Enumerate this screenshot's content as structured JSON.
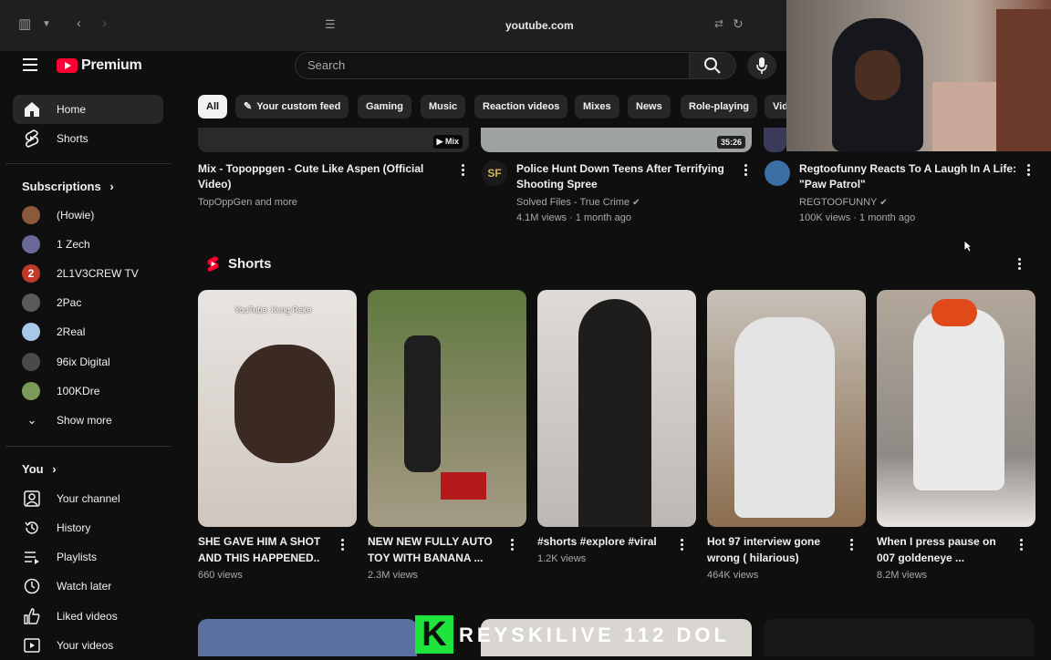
{
  "browser": {
    "url": "youtube.com"
  },
  "header": {
    "brand": "Premium",
    "search_placeholder": "Search"
  },
  "sidebar": {
    "main": [
      {
        "label": "Home",
        "icon": "home-icon",
        "active": true
      },
      {
        "label": "Shorts",
        "icon": "shorts-icon",
        "active": false
      }
    ],
    "subscriptions_heading": "Subscriptions",
    "subscriptions": [
      {
        "label": "(Howie)",
        "color": "#8a5a3a"
      },
      {
        "label": "1 Zech",
        "color": "#6a6a9a"
      },
      {
        "label": "2L1V3CREW TV",
        "color": "#c0392b",
        "glyph": "2"
      },
      {
        "label": "2Pac",
        "color": "#5a5a5a"
      },
      {
        "label": "2Real",
        "color": "#a8c8e8"
      },
      {
        "label": "96ix Digital",
        "color": "#4a4a4a"
      },
      {
        "label": "100KDre",
        "color": "#7a9a5a"
      }
    ],
    "show_more": "Show more",
    "you_heading": "You",
    "you_items": [
      {
        "label": "Your channel",
        "icon": "channel-icon"
      },
      {
        "label": "History",
        "icon": "history-icon"
      },
      {
        "label": "Playlists",
        "icon": "playlists-icon"
      },
      {
        "label": "Watch later",
        "icon": "watch-later-icon"
      },
      {
        "label": "Liked videos",
        "icon": "thumbs-up-icon"
      },
      {
        "label": "Your videos",
        "icon": "your-videos-icon"
      }
    ]
  },
  "chips": [
    "All",
    "Your custom feed",
    "Gaming",
    "Music",
    "Reaction videos",
    "Mixes",
    "News",
    "Role-playing",
    "Vid"
  ],
  "videos": [
    {
      "title_line1": "Mix - Topoppgen - Cute Like Aspen (Official",
      "title_line2": "Video)",
      "meta1": "TopOppGen and more",
      "meta2": "",
      "badge": "Mix",
      "avatar": ""
    },
    {
      "title_line1": "Police Hunt Down Teens After Terrifying",
      "title_line2": "Shooting Spree",
      "meta1": "Solved Files - True Crime",
      "meta2": "4.1M views · 1 month ago",
      "badge": "35:26",
      "avatar": "SF"
    },
    {
      "title_line1": "Regtoofunny Reacts To A Laugh In A Life:",
      "title_line2": "\"Paw Patrol\"",
      "meta1": "REGTOOFUNNY",
      "meta2": "100K views · 1 month ago",
      "badge": "",
      "avatar": ""
    }
  ],
  "shorts_heading": "Shorts",
  "shorts": [
    {
      "line1": "SHE GAVE HIM A SHOT",
      "line2": "AND THIS HAPPENED..",
      "views": "660 views",
      "thumb_text": "YouTube: Kvng Reke",
      "bg": "#d9d3cf"
    },
    {
      "line1": "NEW NEW FULLY AUTO",
      "line2": "TOY WITH BANANA ...",
      "views": "2.3M views",
      "thumb_text": "",
      "bg": "#6d7d4e"
    },
    {
      "line1": "#shorts #explore #viral",
      "line2": "",
      "views": "1.2K views",
      "thumb_text": "",
      "bg": "#c9c5c2"
    },
    {
      "line1": "Hot 97 interview gone",
      "line2": "wrong ( hilarious)",
      "views": "464K views",
      "thumb_text": "",
      "bg": "#9b8a76"
    },
    {
      "line1": "When I press pause on",
      "line2": "007 goldeneye ...",
      "views": "8.2M views",
      "thumb_text": "",
      "bg": "#b9ab9b"
    }
  ],
  "overlay": {
    "k": "K",
    "text": "REYSKILIVE  112 DOL"
  }
}
